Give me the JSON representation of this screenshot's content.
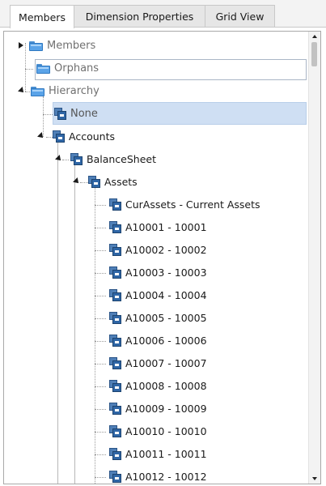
{
  "tabs": [
    {
      "label": "Members",
      "active": true
    },
    {
      "label": "Dimension Properties",
      "active": false
    },
    {
      "label": "Grid View",
      "active": false
    }
  ],
  "tree": {
    "roots": [
      {
        "label": "Members",
        "icon": "folder-icon",
        "expanded": false
      },
      {
        "label": "Orphans",
        "icon": "folder-icon"
      },
      {
        "label": "Hierarchy",
        "icon": "folder-icon",
        "expanded": true
      }
    ],
    "none_label": "None",
    "accounts_label": "Accounts",
    "balance_label": "BalanceSheet",
    "assets_label": "Assets",
    "leaves": [
      "CurAssets - Current Assets",
      "A10001 - 10001",
      "A10002 - 10002",
      "A10003 - 10003",
      "A10004 - 10004",
      "A10005 - 10005",
      "A10006 - 10006",
      "A10007 - 10007",
      "A10008 - 10008",
      "A10009 - 10009",
      "A10010 - 10010",
      "A10011 - 10011",
      "A10012 - 10012"
    ]
  },
  "colors": {
    "selection": "#cfdff3",
    "folder": "#5aa3e8",
    "member_icon": "#2f66a6"
  }
}
